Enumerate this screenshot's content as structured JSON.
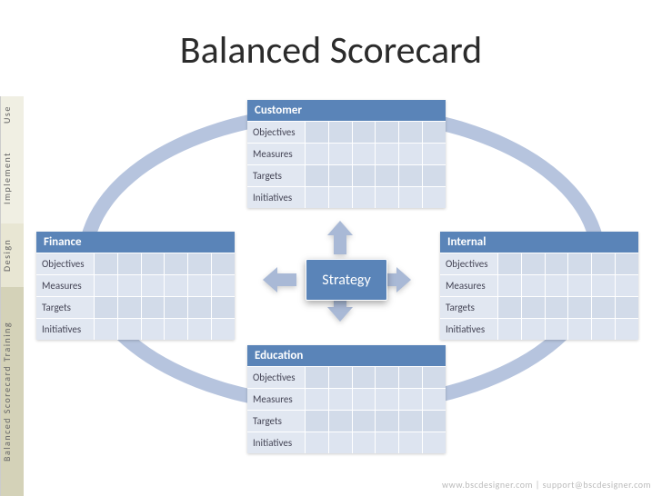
{
  "title": "Balanced Scorecard",
  "side_tabs": {
    "training": "Balanced Scorecard Training",
    "design": "Design",
    "implement": "Implement",
    "use": "Use"
  },
  "center": "Strategy",
  "row_labels": [
    "Objectives",
    "Measures",
    "Targets",
    "Initiatives"
  ],
  "perspectives": {
    "top": {
      "title": "Customer"
    },
    "left": {
      "title": "Finance"
    },
    "right": {
      "title": "Internal"
    },
    "bottom": {
      "title": "Education"
    }
  },
  "footer": "www.bscdesigner.com | support@bscdesigner.com"
}
